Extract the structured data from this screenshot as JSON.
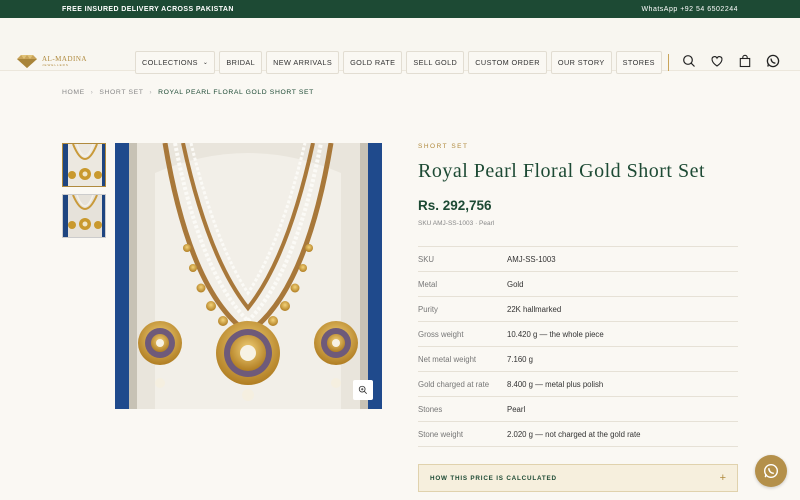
{
  "topbar": {
    "left_text": "FREE INSURED DELIVERY ACROSS PAKISTAN",
    "right_text": "WhatsApp +92 54 6502244"
  },
  "logo": {
    "name": "AL-MADINA",
    "subtitle": "JEWELLERS",
    "icon": "diamond-icon"
  },
  "nav": {
    "items": [
      {
        "label": "COLLECTIONS",
        "has_dropdown": true
      },
      {
        "label": "BRIDAL"
      },
      {
        "label": "NEW ARRIVALS"
      },
      {
        "label": "GOLD RATE"
      },
      {
        "label": "SELL GOLD"
      },
      {
        "label": "CUSTOM ORDER"
      },
      {
        "label": "OUR STORY"
      },
      {
        "label": "STORES"
      }
    ]
  },
  "header_icons": [
    "search-icon",
    "heart-icon",
    "bag-icon",
    "whatsapp-icon"
  ],
  "breadcrumb": {
    "home": "HOME",
    "category": "SHORT SET",
    "current": "ROYAL PEARL FLORAL GOLD SHORT SET"
  },
  "product": {
    "category": "SHORT SET",
    "title": "Royal Pearl Floral Gold Short Set",
    "price": "Rs. 292,756",
    "sku_line": "SKU AMJ-SS-1003 · Pearl",
    "specs": [
      {
        "label": "SKU",
        "value": "AMJ-SS-1003"
      },
      {
        "label": "Metal",
        "value": "Gold"
      },
      {
        "label": "Purity",
        "value": "22K hallmarked"
      },
      {
        "label": "Gross weight",
        "value": "10.420 g — the whole piece"
      },
      {
        "label": "Net metal weight",
        "value": "7.160 g"
      },
      {
        "label": "Gold charged at rate",
        "value": "8.400 g — metal plus polish"
      },
      {
        "label": "Stones",
        "value": "Pearl"
      },
      {
        "label": "Stone weight",
        "value": "2.020 g — not charged at the gold rate"
      }
    ],
    "price_calc_label": "HOW THIS PRICE IS CALCULATED",
    "price_calc_toggle": "+"
  },
  "colors": {
    "brand_green": "#1d4a34",
    "gold_accent": "#b08a3e",
    "background": "#faf8f3"
  }
}
